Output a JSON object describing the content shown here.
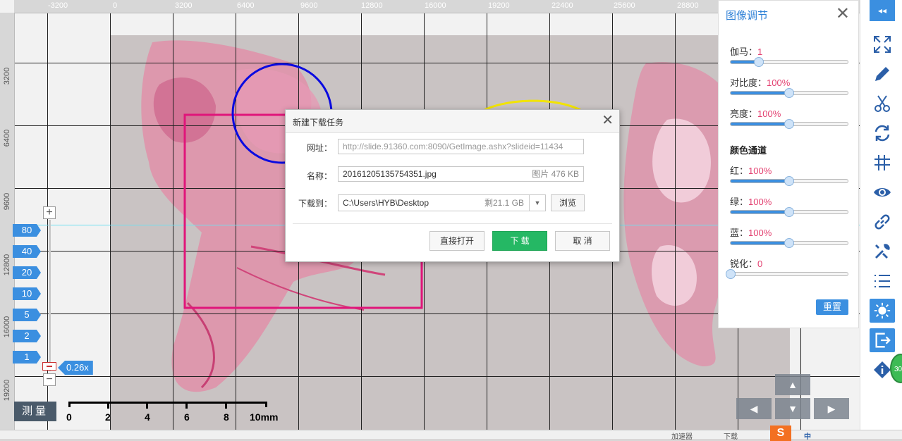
{
  "ruler": {
    "top": [
      "-3200",
      "0",
      "3200",
      "6400",
      "9600",
      "12800",
      "16000",
      "19200",
      "22400",
      "25600",
      "28800"
    ],
    "left": [
      "3200",
      "6400",
      "9600",
      "12800",
      "16000",
      "19200"
    ]
  },
  "zoom": {
    "plus": "+",
    "minus": "−",
    "levels": [
      "80",
      "40",
      "20",
      "10",
      "5",
      "2",
      "1"
    ],
    "current": "0.26x"
  },
  "measure": {
    "label": "测量"
  },
  "scale": {
    "labels": [
      "0",
      "2",
      "4",
      "6",
      "8",
      "10mm"
    ]
  },
  "dialog": {
    "title": "新建下载任务",
    "close": "✕",
    "url_label": "网址：",
    "url_value": "http://slide.91360.com:8090/GetImage.ashx?slideid=11434",
    "name_label": "名称：",
    "name_value": "20161205135754351.jpg",
    "name_meta": "图片 476 KB",
    "dest_label": "下载到：",
    "dest_value": "C:\\Users\\HYB\\Desktop",
    "dest_free": "剩21.1 GB",
    "browse": "浏览",
    "open_direct": "直接打开",
    "download": "下 载",
    "cancel": "取 消"
  },
  "panel": {
    "title": "图像调节",
    "close": "✕",
    "gamma": {
      "label": "伽马：",
      "value": "1",
      "level": 0.24
    },
    "contrast": {
      "label": "对比度：",
      "value": "100%",
      "level": 0.5
    },
    "brightness": {
      "label": "亮度：",
      "value": "100%",
      "level": 0.5
    },
    "channels_title": "颜色通道",
    "red": {
      "label": "红：",
      "value": "100%",
      "level": 0.5
    },
    "green": {
      "label": "绿：",
      "value": "100%",
      "level": 0.5
    },
    "blue": {
      "label": "蓝：",
      "value": "100%",
      "level": 0.5
    },
    "sharpen": {
      "label": "锐化：",
      "value": "0",
      "level": 0.0
    },
    "reset": "重置"
  },
  "toolbar": {
    "collapse": "◂◂",
    "icons": [
      "fullscreen-icon",
      "pencil-icon",
      "scissors-icon",
      "rotate-icon",
      "grid-icon",
      "eye-icon",
      "link-icon",
      "tools-icon",
      "list-icon",
      "brightness-icon",
      "export-icon",
      "info-icon"
    ]
  },
  "badge": {
    "text": "30"
  },
  "nav": {
    "up": "▲",
    "down": "▼",
    "left": "◀",
    "right": "▶"
  },
  "status": {
    "accel": "加速器",
    "download": "下载",
    "ime": "中"
  },
  "colors": {
    "accent": "#3b8fe0",
    "download_green": "#25b864",
    "value_pink": "#e34070"
  }
}
